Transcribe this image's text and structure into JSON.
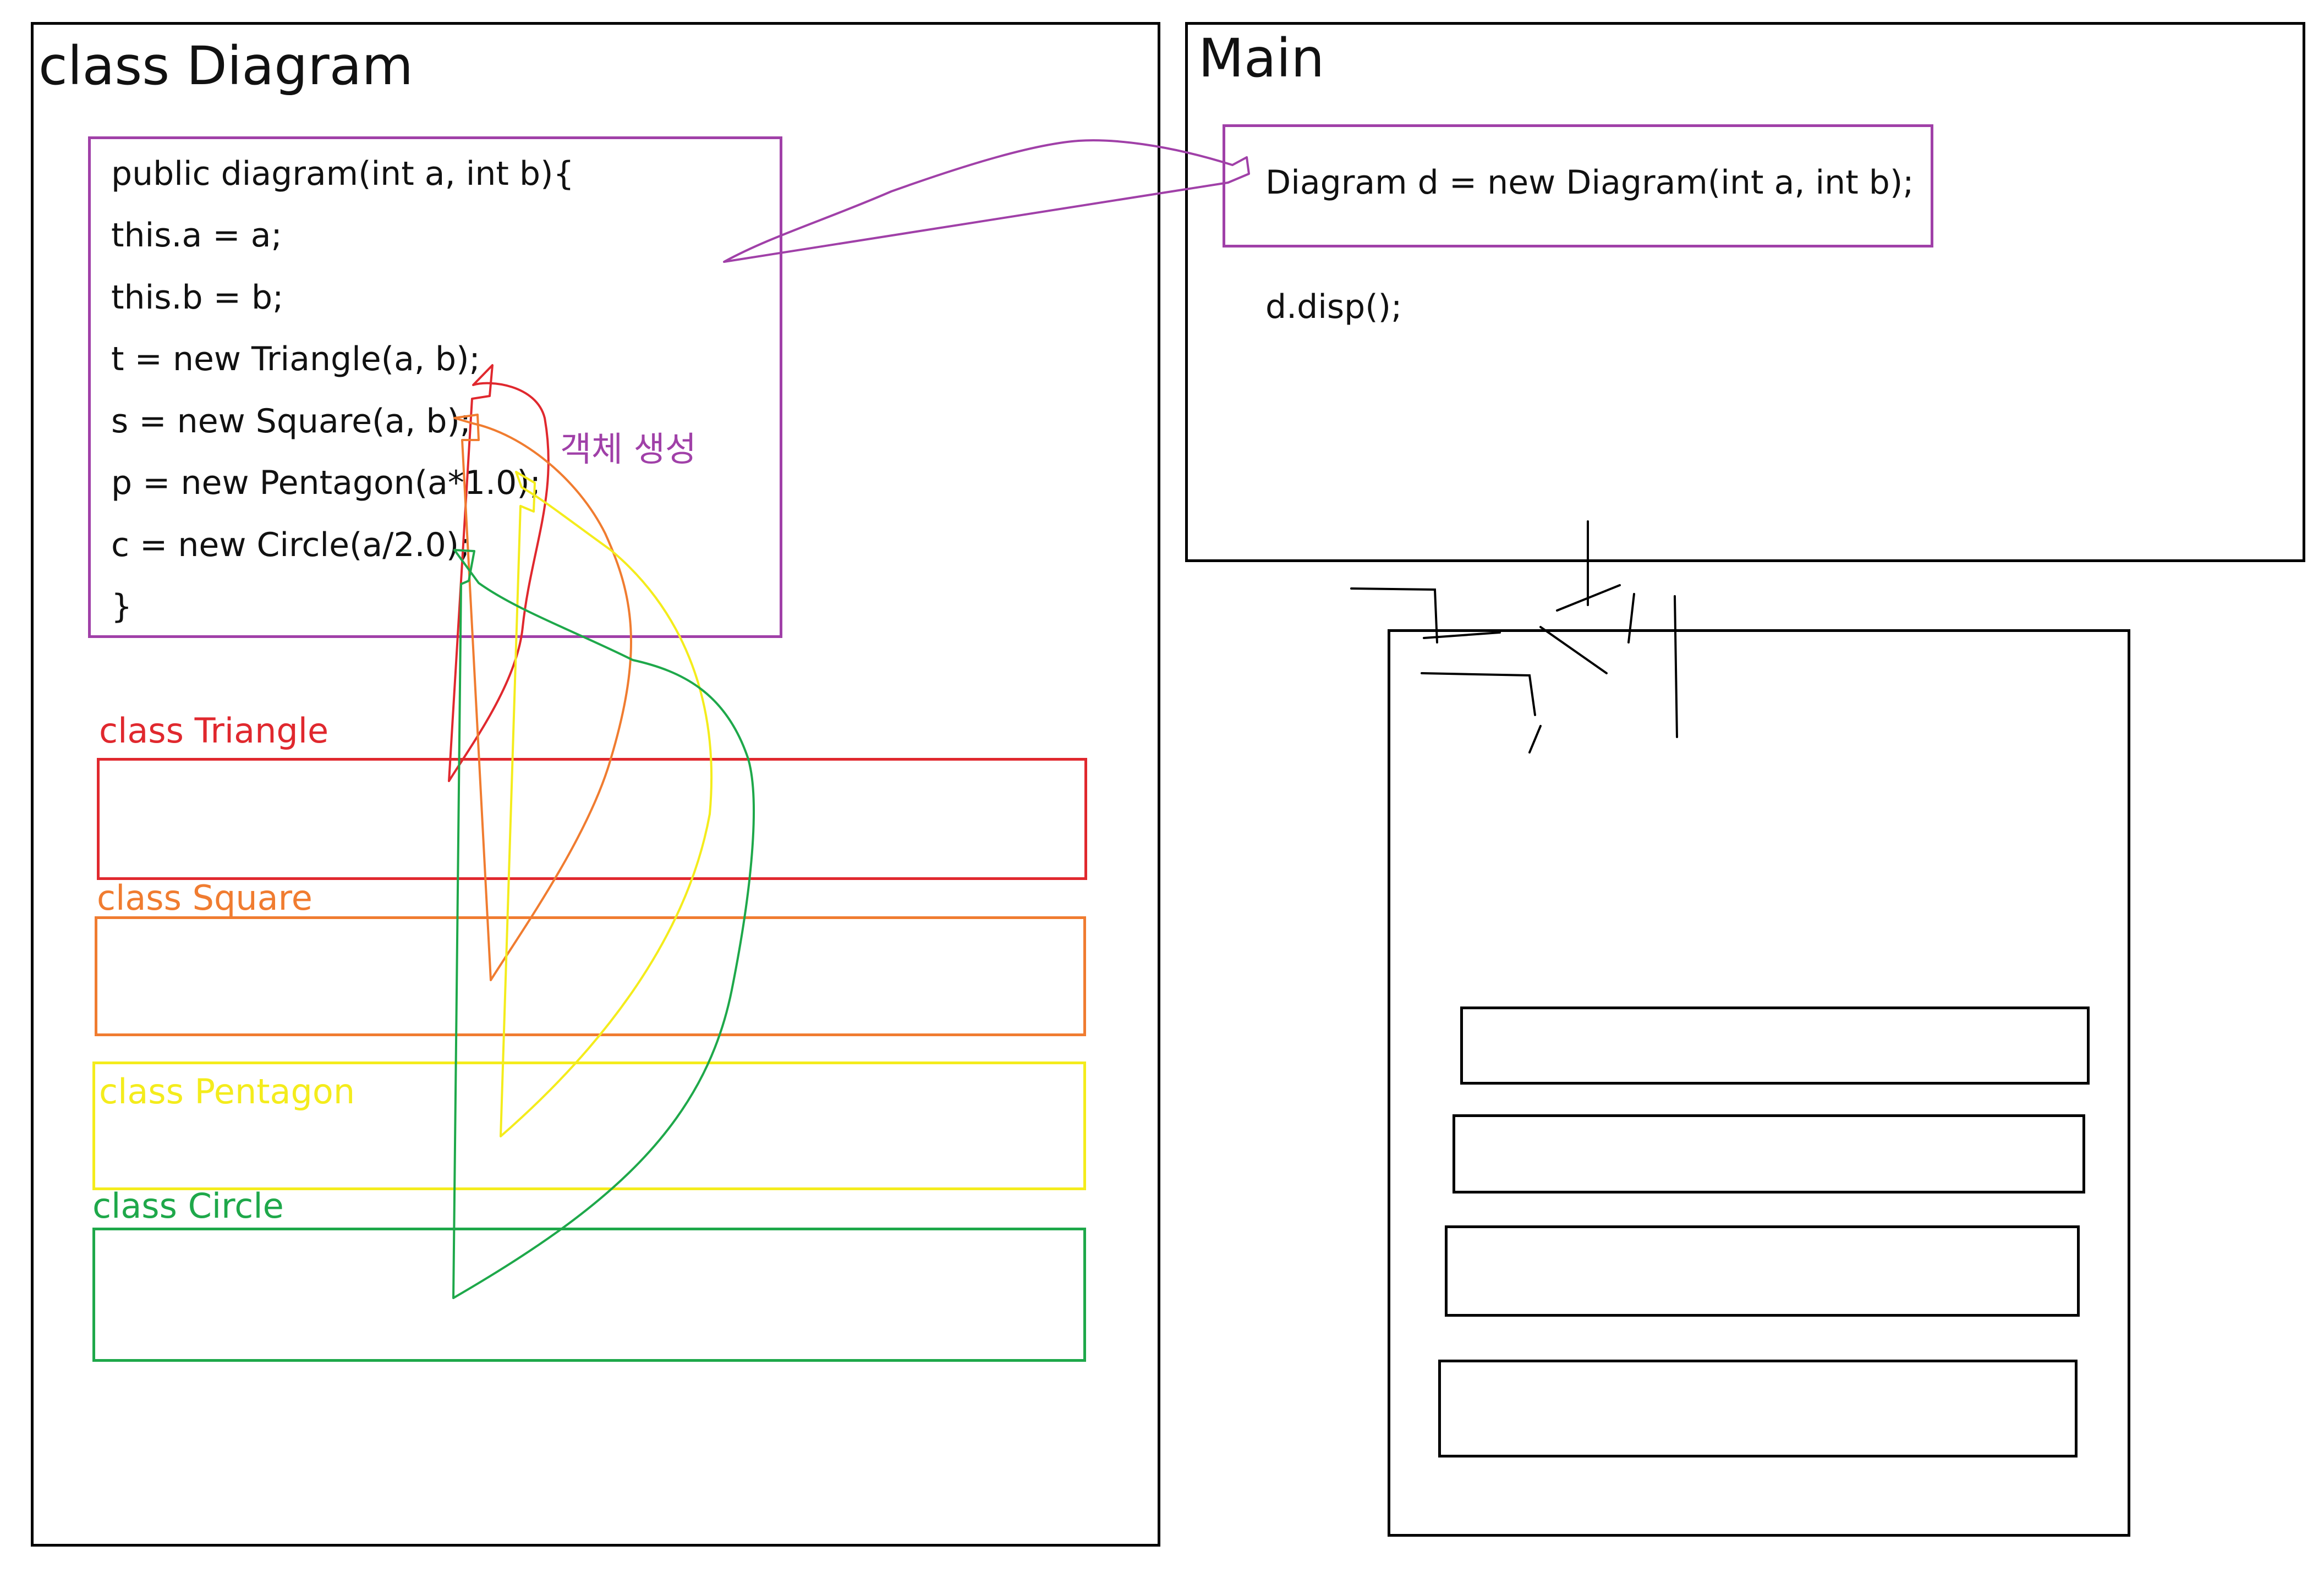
{
  "diagram_panel": {
    "title": "class Diagram",
    "constructor_lines": [
      "public diagram(int a, int b){",
      "this.a = a;",
      "this.b = b;",
      "t = new Triangle(a, b);",
      "s = new Square(a, b);",
      "p = new Pentagon(a*1.0);",
      "c = new Circle(a/2.0);",
      "}"
    ],
    "annotation": "객체 생성",
    "classes": [
      {
        "label": "class Triangle",
        "color": "#e0282e"
      },
      {
        "label": "class Square",
        "color": "#f07c30"
      },
      {
        "label": "class Pentagon",
        "color": "#f4ec1c"
      },
      {
        "label": "class Circle",
        "color": "#1ea84a"
      }
    ],
    "constructor_box_color": "#a040a8"
  },
  "main_panel": {
    "title": "Main",
    "statement": "Diagram d = new Diagram(int a, int b);",
    "call": "d.disp();"
  },
  "object_panel": {
    "handwritten_label": "객체",
    "slot_count": 4
  }
}
